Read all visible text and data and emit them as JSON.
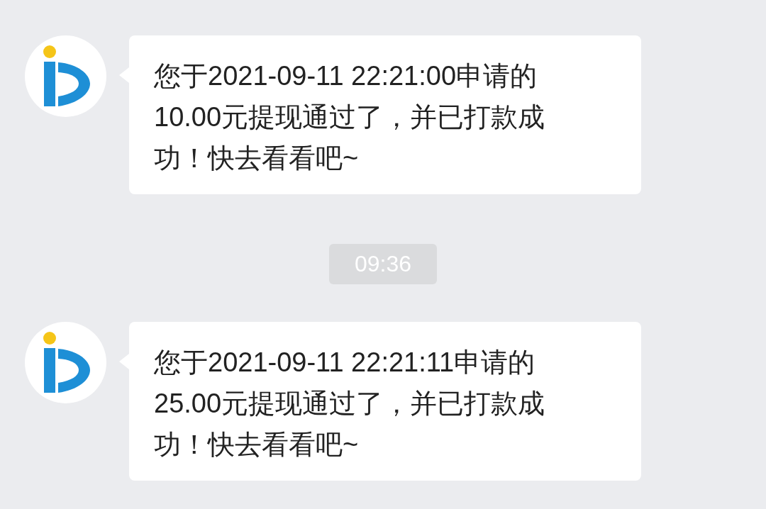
{
  "messages": [
    {
      "kind": "message",
      "text": "您于2021-09-11 22:21:00申请的10.00元提现通过了，并已打款成功！快去看看吧~"
    },
    {
      "kind": "time",
      "text": "09:36"
    },
    {
      "kind": "message",
      "text": "您于2021-09-11 22:21:11申请的25.00元提现通过了，并已打款成功！快去看看吧~"
    }
  ]
}
